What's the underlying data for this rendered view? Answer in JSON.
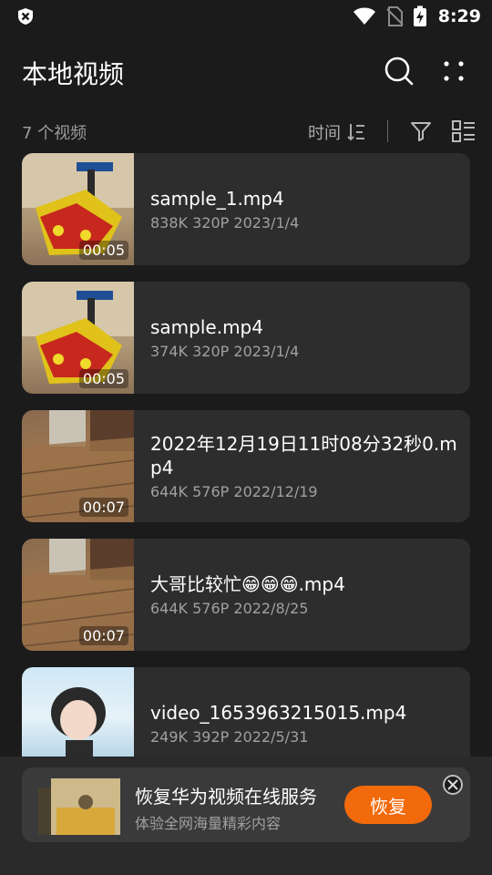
{
  "status_bar": {
    "time": "8:29"
  },
  "header": {
    "title": "本地视频"
  },
  "toolbar": {
    "count_label": "7 个视频",
    "sort_label": "时间"
  },
  "videos": [
    {
      "name": "sample_1.mp4",
      "meta": "838K 320P 2023/1/4",
      "duration": "00:05"
    },
    {
      "name": "sample.mp4",
      "meta": "374K 320P 2023/1/4",
      "duration": "00:05"
    },
    {
      "name": "2022年12月19日11时08分32秒0.mp4",
      "meta": "644K 576P 2022/12/19",
      "duration": "00:07"
    },
    {
      "name": "大哥比较忙😁😁😁.mp4",
      "meta": "644K 576P 2022/8/25",
      "duration": "00:07"
    },
    {
      "name": "video_1653963215015.mp4",
      "meta": "249K 392P 2022/5/31",
      "duration": ""
    }
  ],
  "ad": {
    "title": "恢复华为视频在线服务",
    "subtitle": "体验全网海量精彩内容",
    "button": "恢复"
  },
  "colors": {
    "accent": "#f26a0b",
    "card": "#2d2d2e",
    "background": "#1b1b1c"
  }
}
